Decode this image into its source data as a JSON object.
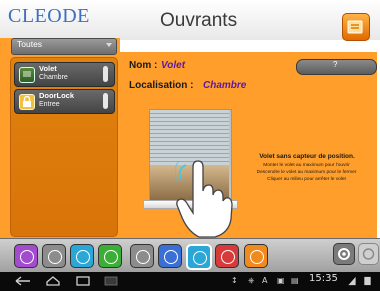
{
  "header": {
    "logo": "CLEODE",
    "title": "Ouvrants"
  },
  "filter": {
    "selected": "Toutes"
  },
  "devices": [
    {
      "name": "Volet",
      "room": "Chambre",
      "icon": "shutter-icon"
    },
    {
      "name": "DoorLock",
      "room": "Entree",
      "icon": "padlock-icon"
    }
  ],
  "detail": {
    "nom_label": "Nom :",
    "nom_value": "Volet",
    "loc_label": "Localisation :",
    "loc_value": "Chambre",
    "help_label": "?",
    "desc_title": "Volet sans capteur de position.",
    "desc_lines": [
      "Monter le volet au maximum pour l'ouvrir",
      "Descendre le volet au maximum pour le fermer",
      "Cliquer au milieu pour arrêter le volet"
    ]
  },
  "bottom_bar": {
    "icons": [
      {
        "name": "alarm-icon",
        "color": "#a24bcf"
      },
      {
        "name": "bin-icon",
        "color": "#8c8c8c"
      },
      {
        "name": "home-icon",
        "color": "#2aa7d6"
      },
      {
        "name": "plug-icon",
        "color": "#3cae38"
      },
      {
        "name": "thermometer-icon",
        "color": "#8c8c8c"
      },
      {
        "name": "person-icon",
        "color": "#3a6fd6"
      },
      {
        "name": "shutter-icon",
        "color": "#2aa7d6"
      },
      {
        "name": "camera-icon",
        "color": "#d63a3a"
      },
      {
        "name": "walking-icon",
        "color": "#f08a1c"
      }
    ]
  },
  "status_bar": {
    "time": "15:35"
  },
  "colors": {
    "accent": "#ff9e2a",
    "value_text": "#5a1aa8",
    "logo": "#3d6fc2"
  }
}
